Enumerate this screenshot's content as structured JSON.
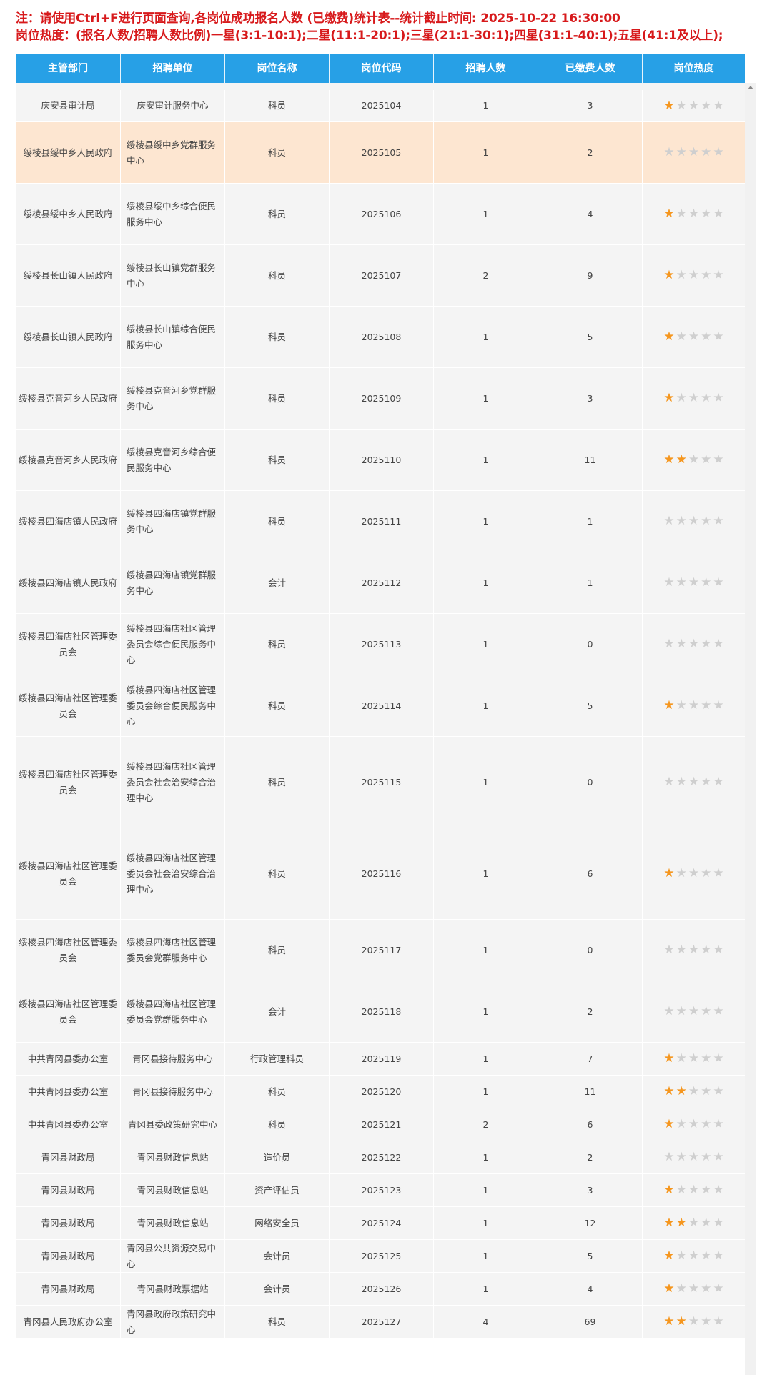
{
  "notice": {
    "line1": "注：请使用Ctrl+F进行页面查询,各岗位成功报名人数 (已缴费)统计表--统计截止时间: 2025-10-22 16:30:00",
    "line2": "岗位热度：(报名人数/招聘人数比例)一星(3:1-10:1);二星(11:1-20:1);三星(21:1-30:1);四星(31:1-40:1);五星(41:1及以上);"
  },
  "colors": {
    "header_bg": "#27a0e6",
    "notice_red": "#d7191b",
    "star_on": "#f5961e",
    "star_off": "#cfcfcf",
    "row_highlight": "#fde6d1"
  },
  "table": {
    "headers": [
      "主管部门",
      "招聘单位",
      "岗位名称",
      "岗位代码",
      "招聘人数",
      "已缴费人数",
      "岗位热度"
    ],
    "rows": [
      {
        "dept": "庆安县审计局",
        "unit": "庆安审计服务中心",
        "post": "科员",
        "code": "2025104",
        "hire": "1",
        "paid": "3",
        "stars": 1
      },
      {
        "dept": "绥棱县绥中乡人民政府",
        "unit": "绥棱县绥中乡党群服务中心",
        "post": "科员",
        "code": "2025105",
        "hire": "1",
        "paid": "2",
        "stars": 0,
        "highlight": true
      },
      {
        "dept": "绥棱县绥中乡人民政府",
        "unit": "绥棱县绥中乡综合便民服务中心",
        "post": "科员",
        "code": "2025106",
        "hire": "1",
        "paid": "4",
        "stars": 1
      },
      {
        "dept": "绥棱县长山镇人民政府",
        "unit": "绥棱县长山镇党群服务中心",
        "post": "科员",
        "code": "2025107",
        "hire": "2",
        "paid": "9",
        "stars": 1
      },
      {
        "dept": "绥棱县长山镇人民政府",
        "unit": "绥棱县长山镇综合便民服务中心",
        "post": "科员",
        "code": "2025108",
        "hire": "1",
        "paid": "5",
        "stars": 1
      },
      {
        "dept": "绥棱县克音河乡人民政府",
        "unit": "绥棱县克音河乡党群服务中心",
        "post": "科员",
        "code": "2025109",
        "hire": "1",
        "paid": "3",
        "stars": 1
      },
      {
        "dept": "绥棱县克音河乡人民政府",
        "unit": "绥棱县克音河乡综合便民服务中心",
        "post": "科员",
        "code": "2025110",
        "hire": "1",
        "paid": "11",
        "stars": 2
      },
      {
        "dept": "绥棱县四海店镇人民政府",
        "unit": "绥棱县四海店镇党群服务中心",
        "post": "科员",
        "code": "2025111",
        "hire": "1",
        "paid": "1",
        "stars": 0
      },
      {
        "dept": "绥棱县四海店镇人民政府",
        "unit": "绥棱县四海店镇党群服务中心",
        "post": "会计",
        "code": "2025112",
        "hire": "1",
        "paid": "1",
        "stars": 0
      },
      {
        "dept": "绥棱县四海店社区管理委员会",
        "unit": "绥棱县四海店社区管理委员会综合便民服务中心",
        "post": "科员",
        "code": "2025113",
        "hire": "1",
        "paid": "0",
        "stars": 0
      },
      {
        "dept": "绥棱县四海店社区管理委员会",
        "unit": "绥棱县四海店社区管理委员会综合便民服务中心",
        "post": "科员",
        "code": "2025114",
        "hire": "1",
        "paid": "5",
        "stars": 1
      },
      {
        "dept": "绥棱县四海店社区管理委员会",
        "unit": "绥棱县四海店社区管理委员会社会治安综合治理中心",
        "post": "科员",
        "code": "2025115",
        "hire": "1",
        "paid": "0",
        "stars": 0
      },
      {
        "dept": "绥棱县四海店社区管理委员会",
        "unit": "绥棱县四海店社区管理委员会社会治安综合治理中心",
        "post": "科员",
        "code": "2025116",
        "hire": "1",
        "paid": "6",
        "stars": 1
      },
      {
        "dept": "绥棱县四海店社区管理委员会",
        "unit": "绥棱县四海店社区管理委员会党群服务中心",
        "post": "科员",
        "code": "2025117",
        "hire": "1",
        "paid": "0",
        "stars": 0
      },
      {
        "dept": "绥棱县四海店社区管理委员会",
        "unit": "绥棱县四海店社区管理委员会党群服务中心",
        "post": "会计",
        "code": "2025118",
        "hire": "1",
        "paid": "2",
        "stars": 0
      },
      {
        "dept": "中共青冈县委办公室",
        "unit": "青冈县接待服务中心",
        "post": "行政管理科员",
        "code": "2025119",
        "hire": "1",
        "paid": "7",
        "stars": 1
      },
      {
        "dept": "中共青冈县委办公室",
        "unit": "青冈县接待服务中心",
        "post": "科员",
        "code": "2025120",
        "hire": "1",
        "paid": "11",
        "stars": 2
      },
      {
        "dept": "中共青冈县委办公室",
        "unit": "青冈县委政策研究中心",
        "post": "科员",
        "code": "2025121",
        "hire": "2",
        "paid": "6",
        "stars": 1
      },
      {
        "dept": "青冈县财政局",
        "unit": "青冈县财政信息站",
        "post": "造价员",
        "code": "2025122",
        "hire": "1",
        "paid": "2",
        "stars": 0
      },
      {
        "dept": "青冈县财政局",
        "unit": "青冈县财政信息站",
        "post": "资产评估员",
        "code": "2025123",
        "hire": "1",
        "paid": "3",
        "stars": 1
      },
      {
        "dept": "青冈县财政局",
        "unit": "青冈县财政信息站",
        "post": "网络安全员",
        "code": "2025124",
        "hire": "1",
        "paid": "12",
        "stars": 2
      },
      {
        "dept": "青冈县财政局",
        "unit": "青冈县公共资源交易中心",
        "post": "会计员",
        "code": "2025125",
        "hire": "1",
        "paid": "5",
        "stars": 1
      },
      {
        "dept": "青冈县财政局",
        "unit": "青冈县财政票据站",
        "post": "会计员",
        "code": "2025126",
        "hire": "1",
        "paid": "4",
        "stars": 1
      },
      {
        "dept": "青冈县人民政府办公室",
        "unit": "青冈县政府政策研究中心",
        "post": "科员",
        "code": "2025127",
        "hire": "4",
        "paid": "69",
        "stars": 2
      }
    ]
  }
}
